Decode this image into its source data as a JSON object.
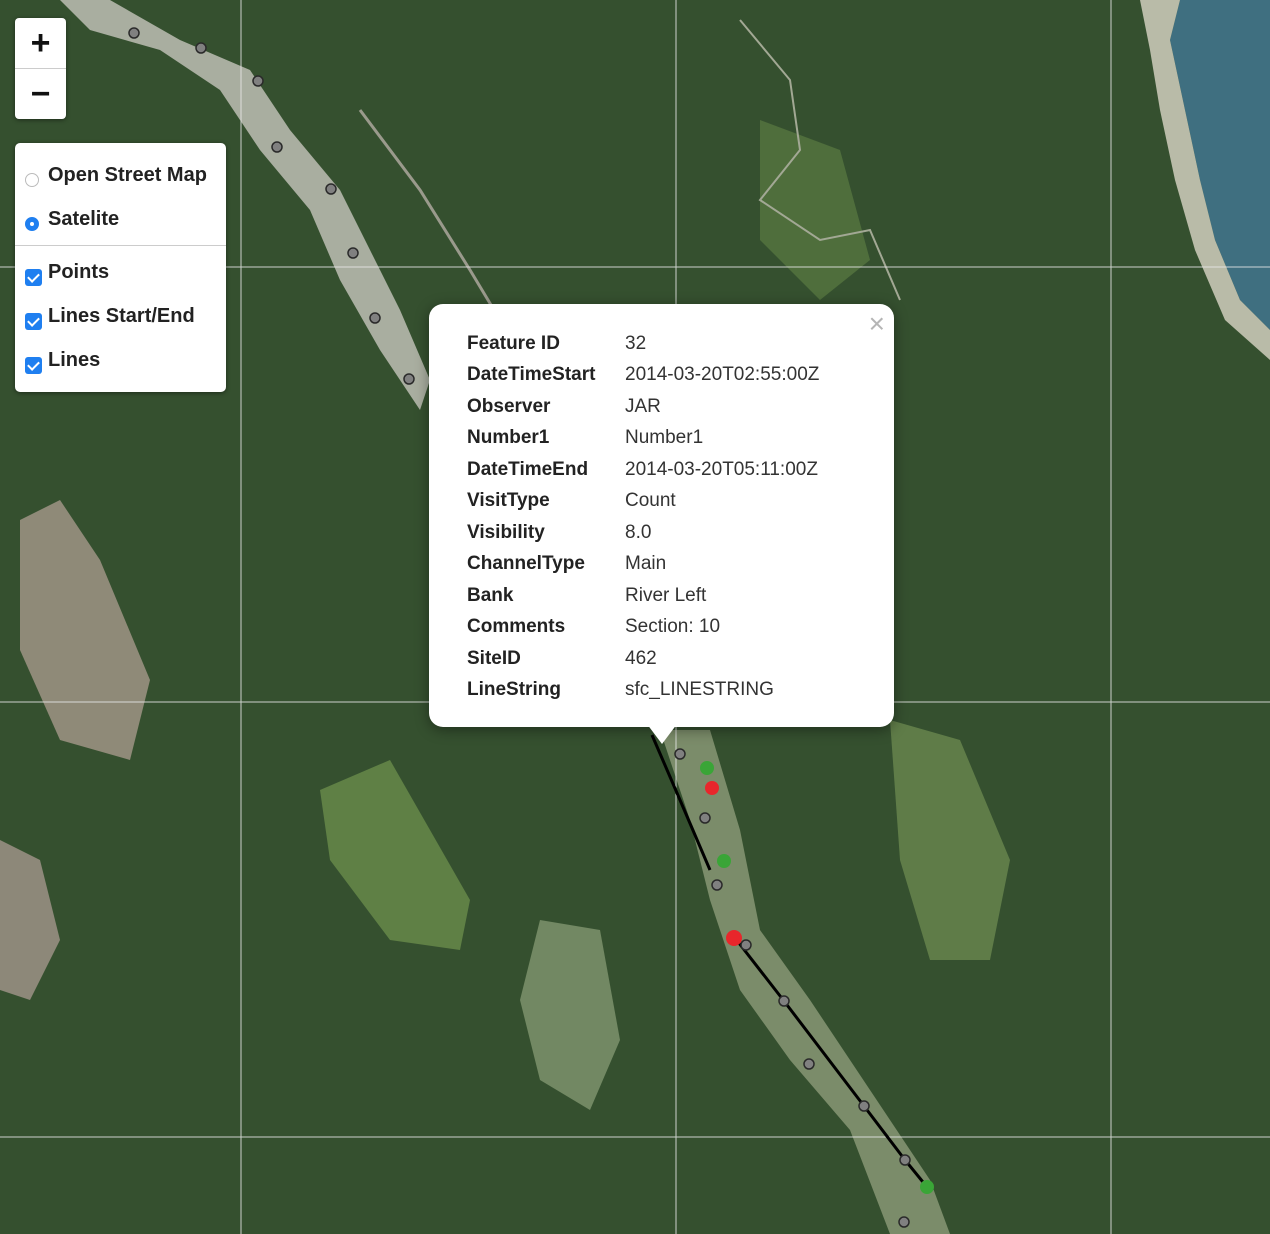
{
  "zoom": {
    "in_label": "+",
    "out_label": "−"
  },
  "layers": {
    "base": [
      {
        "label": "Open Street Map",
        "selected": false
      },
      {
        "label": "Satelite",
        "selected": true
      }
    ],
    "overlays": [
      {
        "label": "Points",
        "checked": true
      },
      {
        "label": "Lines Start/End",
        "checked": true
      },
      {
        "label": "Lines",
        "checked": true
      }
    ]
  },
  "popup": {
    "close_label": "×",
    "rows": [
      {
        "key": "Feature ID",
        "value": "32"
      },
      {
        "key": "DateTimeStart",
        "value": "2014-03-20T02:55:00Z"
      },
      {
        "key": "Observer",
        "value": "JAR"
      },
      {
        "key": "Number1",
        "value": "Number1"
      },
      {
        "key": "DateTimeEnd",
        "value": "2014-03-20T05:11:00Z"
      },
      {
        "key": "VisitType",
        "value": "Count"
      },
      {
        "key": "Visibility",
        "value": "8.0"
      },
      {
        "key": "ChannelType",
        "value": "Main"
      },
      {
        "key": "Bank",
        "value": "River Left"
      },
      {
        "key": "Comments",
        "value": "Section: 10"
      },
      {
        "key": "SiteID",
        "value": "462"
      },
      {
        "key": "LineString",
        "value": "sfc_LINESTRING"
      }
    ]
  },
  "colors": {
    "start_marker": "#3aa537",
    "end_marker": "#e8262b",
    "point_marker": "#808080",
    "line": "#000000",
    "checkbox": "#1f7ff0"
  }
}
